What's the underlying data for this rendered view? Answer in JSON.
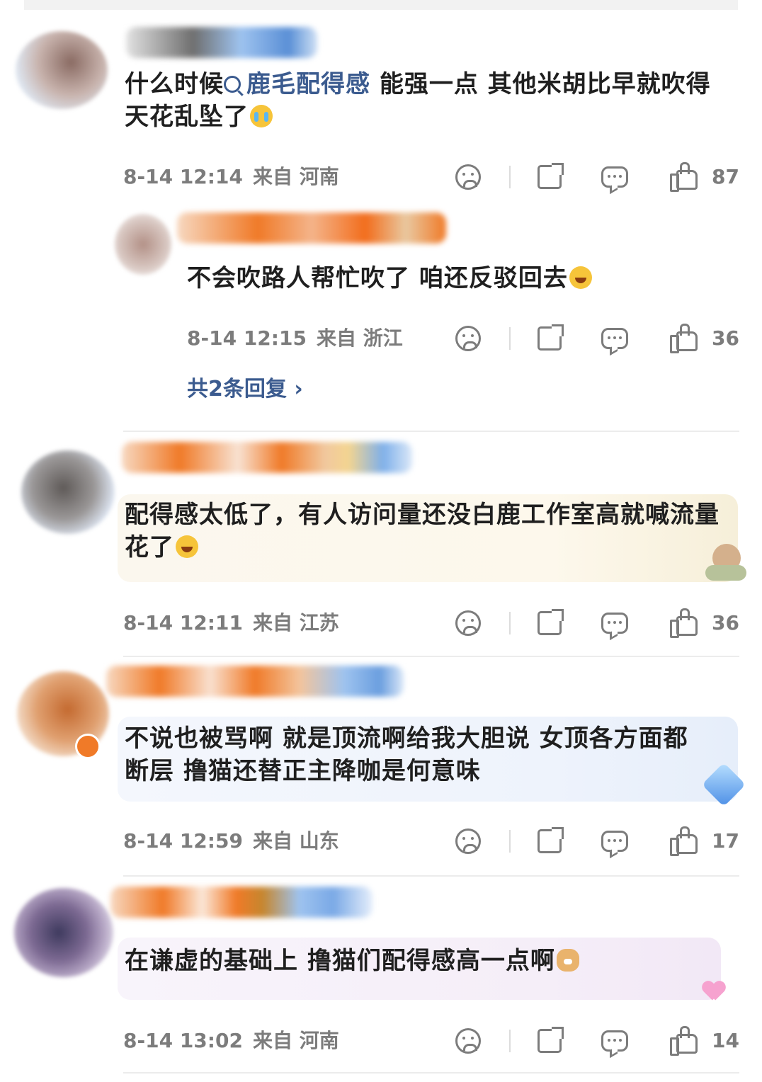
{
  "comments": [
    {
      "text_a": "什么时候",
      "topic": "鹿毛配得感",
      "text_b": " 能强一点 其他米胡比早就吹得天花乱坠了",
      "emoji": "loudly-crying-emoji",
      "time": "8-14 12:14",
      "location": "来自 河南",
      "likes": "87",
      "reply": {
        "text": "不会吹路人帮忙吹了 咱还反驳回去",
        "emoji": "laughing-tears-emoji",
        "time": "8-14 12:15",
        "location": "来自 浙江",
        "likes": "36"
      },
      "more_replies": "共2条回复 ›"
    },
    {
      "text": "配得感太低了，有人访问量还没白鹿工作室高就喊流量花了",
      "emoji": "laughing-tears-emoji",
      "time": "8-14 12:11",
      "location": "来自 江苏",
      "likes": "36"
    },
    {
      "text": "不说也被骂啊 就是顶流啊给我大胆说 女顶各方面都断层 撸猫还替正主降咖是何意味",
      "time": "8-14 12:59",
      "location": "来自 山东",
      "likes": "17"
    },
    {
      "text": "在谦虚的基础上 撸猫们配得感高一点啊",
      "emoji": "dog-face-emoji",
      "time": "8-14 13:02",
      "location": "来自 河南",
      "likes": "14"
    }
  ],
  "icons": {
    "dislike": "sad-face-icon",
    "share": "share-icon",
    "comment": "comment-bubble-icon",
    "like": "thumbs-up-icon"
  },
  "colors": {
    "topic": "#3b5b8f",
    "meta": "#7c7c7c",
    "text": "#1f1f1f"
  }
}
